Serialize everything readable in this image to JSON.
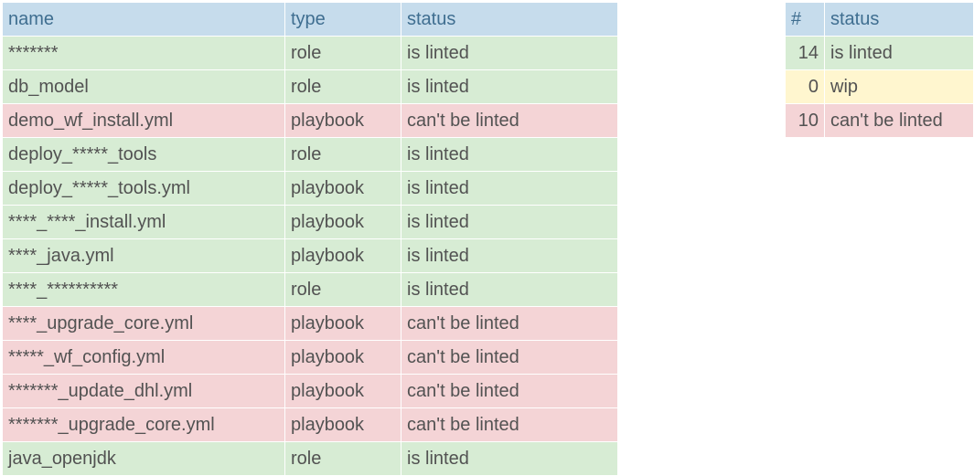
{
  "colors": {
    "header_bg": "#c6dcec",
    "ok": "#d7ecd4",
    "warn": "#fff6cf",
    "bad": "#f4d4d6"
  },
  "status_class": {
    "is linted": "ok",
    "wip": "warn",
    "can't be linted": "bad"
  },
  "main": {
    "headers": [
      "name",
      "type",
      "status"
    ],
    "rows": [
      {
        "name": "*******",
        "type": "role",
        "status": "is linted"
      },
      {
        "name": "db_model",
        "type": "role",
        "status": "is linted"
      },
      {
        "name": "demo_wf_install.yml",
        "type": "playbook",
        "status": "can't be linted"
      },
      {
        "name": "deploy_*****_tools",
        "type": "role",
        "status": "is linted"
      },
      {
        "name": "deploy_*****_tools.yml",
        "type": "playbook",
        "status": "is linted"
      },
      {
        "name": "****_****_install.yml",
        "type": "playbook",
        "status": "is linted"
      },
      {
        "name": "****_java.yml",
        "type": "playbook",
        "status": "is linted"
      },
      {
        "name": "****_**********",
        "type": "role",
        "status": "is linted"
      },
      {
        "name": "****_upgrade_core.yml",
        "type": "playbook",
        "status": "can't be linted"
      },
      {
        "name": "*****_wf_config.yml",
        "type": "playbook",
        "status": "can't be linted"
      },
      {
        "name": "*******_update_dhl.yml",
        "type": "playbook",
        "status": "can't be linted"
      },
      {
        "name": "*******_upgrade_core.yml",
        "type": "playbook",
        "status": "can't be linted"
      },
      {
        "name": "java_openjdk",
        "type": "role",
        "status": "is linted"
      }
    ]
  },
  "summary": {
    "headers": [
      "#",
      "status"
    ],
    "rows": [
      {
        "count": 14,
        "status": "is linted"
      },
      {
        "count": 0,
        "status": "wip"
      },
      {
        "count": 10,
        "status": "can't be linted"
      }
    ]
  }
}
